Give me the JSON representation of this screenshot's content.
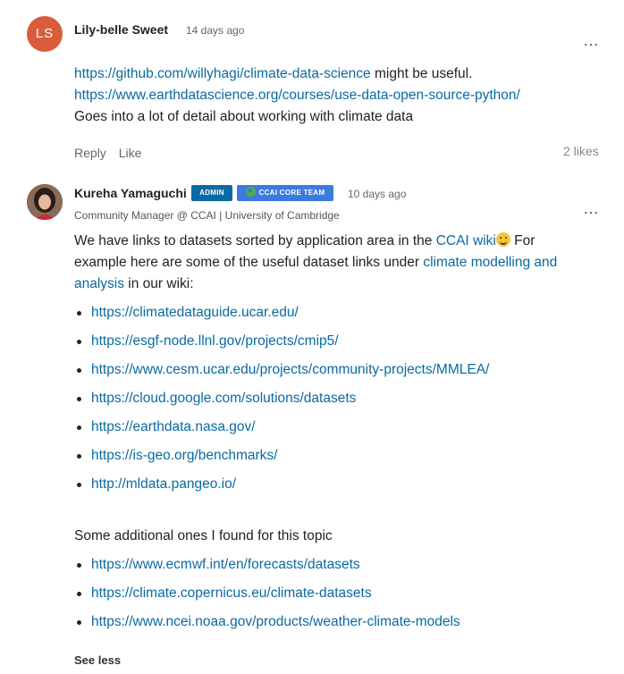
{
  "posts": [
    {
      "avatar_initials": "LS",
      "avatar_color": "#d95c3b",
      "author": "Lily-belle Sweet",
      "date": "14 days ago",
      "more_icon": "…",
      "links": [
        "https://github.com/willyhagi/climate-data-science",
        "https://www.earthdatascience.org/courses/use-data-open-source-python/"
      ],
      "after_link1": " might be useful.",
      "text": "Goes into a lot of detail about working with climate data",
      "reply_label": "Reply",
      "like_label": "Like",
      "likes": "2 likes"
    },
    {
      "author": "Kureha Yamaguchi",
      "badges": [
        "ADMIN",
        "CCAI CORE TEAM"
      ],
      "date": "10 days ago",
      "user_title": "Community Manager @ CCAI | University of Cambridge",
      "more_icon": "…",
      "intro_1": "We have links to datasets sorted by application area in the ",
      "wiki_link": "CCAI wiki",
      "intro_2": "  For example here are some of the useful dataset link under ",
      "intro_2_fixed": "  For example here are some of the useful dataset links under ",
      "topic_link": "climate modelling and analysis",
      "intro_3": " in our wiki:",
      "list1": [
        "https://climatedataguide.ucar.edu/",
        "https://esgf-node.llnl.gov/projects/cmip5/",
        "https://www.cesm.ucar.edu/projects/community-projects/MMLEA/",
        "https://cloud.google.com/solutions/datasets",
        "https://earthdata.nasa.gov/",
        "https://is-geo.org/benchmarks/",
        "http://mldata.pangeo.io/"
      ],
      "additional": "Some additional ones I found for this topic",
      "list2": [
        "https://www.ecmwf.int/en/forecasts/datasets",
        "https://climate.copernicus.eu/climate-datasets",
        "https://www.ncei.noaa.gov/products/weather-climate-models"
      ],
      "see_less": "See less"
    }
  ],
  "colors": {
    "link": "#0a6aa1",
    "admin_badge": "#0a6aa1",
    "core_badge": "#3d7ae0"
  }
}
